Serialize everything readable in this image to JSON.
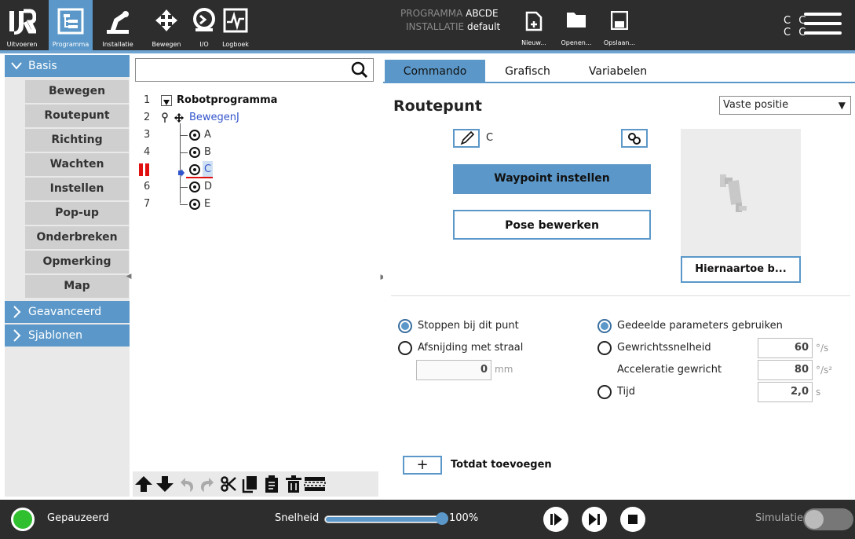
{
  "topbar": {
    "nav": [
      {
        "label": "Uitvoeren",
        "icon": "ur-logo-icon"
      },
      {
        "label": "Programma",
        "icon": "program-tree-icon",
        "active": true
      },
      {
        "label": "Installatie",
        "icon": "robot-arm-icon"
      },
      {
        "label": "Bewegen",
        "icon": "move-arrows-icon"
      },
      {
        "label": "I/O",
        "icon": "io-icon"
      },
      {
        "label": "Logboek",
        "icon": "log-icon"
      }
    ],
    "program_key": "PROGRAMMA",
    "program_val": "ABCDE",
    "install_key": "INSTALLATIE",
    "install_val": "default",
    "file": [
      {
        "label": "Nieuw...",
        "icon": "new-file-icon"
      },
      {
        "label": "Openen...",
        "icon": "folder-icon"
      },
      {
        "label": "Opslaan...",
        "icon": "save-icon"
      }
    ],
    "cc_top": "C C",
    "cc_bottom": "C C"
  },
  "left": {
    "basis": "Basis",
    "items": [
      "Bewegen",
      "Routepunt",
      "Richting",
      "Wachten",
      "Instellen",
      "Pop-up",
      "Onderbreken",
      "Opmerking",
      "Map"
    ],
    "advanced": "Geavanceerd",
    "templates": "Sjablonen"
  },
  "tree": {
    "rows": [
      {
        "num": "1",
        "text": "Robotprogramma"
      },
      {
        "num": "2",
        "text": "BewegenJ"
      },
      {
        "num": "3",
        "text": "A"
      },
      {
        "num": "4",
        "text": "B"
      },
      {
        "num": "5",
        "text": "C"
      },
      {
        "num": "6",
        "text": "D"
      },
      {
        "num": "7",
        "text": "E"
      }
    ]
  },
  "right": {
    "tabs": [
      "Commando",
      "Grafisch",
      "Variabelen"
    ],
    "title": "Routepunt",
    "position_select": "Vaste positie",
    "waypoint_name": "C",
    "set_waypoint": "Waypoint instellen",
    "edit_pose": "Pose bewerken",
    "move_here": "Hiernaartoe b...",
    "stop_at_point": "Stoppen bij dit punt",
    "blend_radius": "Afsnijding met straal",
    "blend_value": "0",
    "blend_unit": "mm",
    "shared_params": "Gedeelde parameters gebruiken",
    "joint_speed": "Gewrichtssnelheid",
    "joint_speed_value": "60",
    "joint_speed_unit": "°/s",
    "joint_accel": "Acceleratie gewricht",
    "joint_accel_value": "80",
    "joint_accel_unit": "°/s²",
    "time": "Tijd",
    "time_value": "2,0",
    "time_unit": "s",
    "until_plus": "+",
    "until_label": "Totdat toevoegen"
  },
  "footer": {
    "status": "Gepauzeerd",
    "speed_label": "Snelheid",
    "speed_value": "100%",
    "speed_fraction": 1.0,
    "sim_label": "Simulatie"
  },
  "colors": {
    "accent": "#5b98c9",
    "topbar": "#2d2d2d",
    "status_green": "#2fbf2f",
    "link_blue": "#3355cc",
    "breakpoint_red": "#e01010"
  }
}
